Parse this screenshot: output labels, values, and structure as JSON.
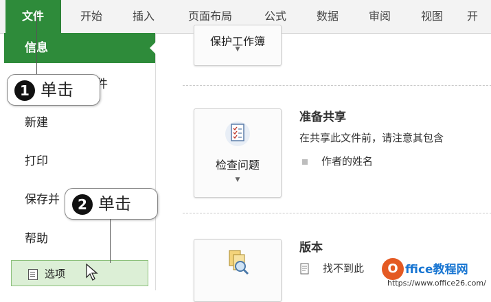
{
  "ribbon": {
    "tabs": [
      "文件",
      "开始",
      "插入",
      "页面布局",
      "公式",
      "数据",
      "审阅",
      "视图",
      "开"
    ]
  },
  "nav": {
    "items": [
      "信息",
      "件",
      "新建",
      "打印",
      "保存并",
      "帮助",
      "选项"
    ]
  },
  "main": {
    "protect_button": "保护工作簿",
    "inspect_button": "检查问题",
    "share_title": "准备共享",
    "share_text": "在共享此文件前，请注意其包含",
    "share_bullet": "作者的姓名",
    "versions_title": "版本",
    "versions_text": "找不到此"
  },
  "callouts": [
    {
      "number": "1",
      "text": "单击"
    },
    {
      "number": "2",
      "text": "单击"
    }
  ],
  "watermark": {
    "logo": "O",
    "title": "ffice教程网",
    "url": "https://www.office26.com/"
  },
  "colors": {
    "accent": "#2e8b3a",
    "options_bg": "#dcefd6",
    "watermark_orange": "#e45a23",
    "watermark_blue": "#1976d2"
  }
}
